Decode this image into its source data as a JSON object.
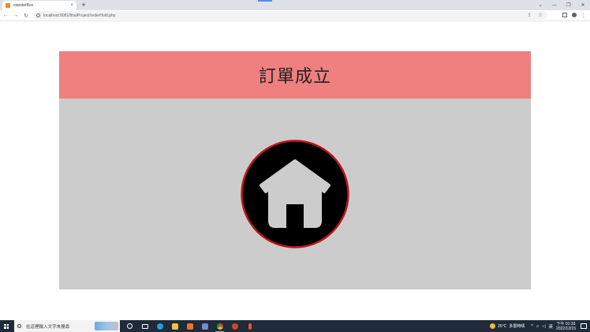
{
  "browser": {
    "tab_title": "standerBox",
    "tab_close": "×",
    "new_tab": "+",
    "url": "localhost:8081/finalProject/orderHold.php",
    "window_controls": [
      "⌄",
      "—",
      "❐",
      "✕"
    ],
    "nav": {
      "back": "←",
      "forward": "→",
      "reload": "↻"
    }
  },
  "page": {
    "title": "訂單成立",
    "header_color": "#f08080",
    "body_color": "#cccccc",
    "home_icon_ring_color": "#c0151b"
  },
  "taskbar": {
    "search_placeholder": "在這裡輸入文字來搜尋",
    "weather_temp": "25°C",
    "weather_text": "多雲時晴",
    "tray_lang": "英",
    "time": "下午 01:33",
    "date": "2022/12/15"
  }
}
